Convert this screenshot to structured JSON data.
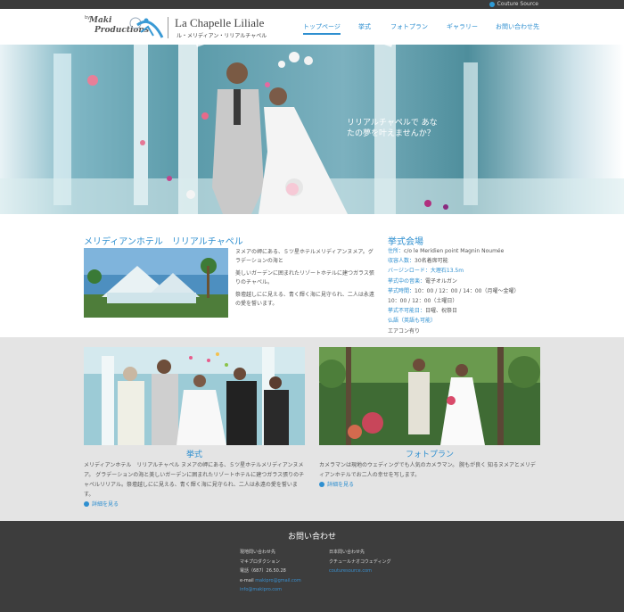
{
  "topbar": {
    "link": "Couture Source"
  },
  "logo": {
    "line1": "Maki",
    "line2": "Productions",
    "prefix": "by"
  },
  "brand": {
    "name": "La Chapelle Liliale",
    "sub": "ル・メリディアン・リリアルチャペル"
  },
  "nav": [
    "トップページ",
    "挙式",
    "フォトプラン",
    "ギャラリー",
    "お問い合わせ先"
  ],
  "hero": {
    "line1": "リリアルチャペルで あな",
    "line2": "たの夢を叶えませんか？"
  },
  "section1": {
    "title": "メリディアンホテル　リリアルチャペル",
    "p1": "ヌメアの岬にある、５ツ星ホテルメリディアンヌメア。グラデーションの海と",
    "p2": "美しいガーデンに囲まれたリゾートホテルに建つガラス張りのチャペル。",
    "p3": "祭壇越しにに見える、青く輝く海に見守られ、二人は永遠の愛を誓います。"
  },
  "info": {
    "title": "挙式会場",
    "rows": [
      {
        "k": "住所：",
        "v": "c/o le Meridien point Magnin Noumée"
      },
      {
        "k": "収容人数：",
        "v": "30名着席可能"
      },
      {
        "k": "バージンロード：",
        "v": "大理石13.5m"
      },
      {
        "k": "挙式中の音楽：",
        "v": "電子オルガン"
      },
      {
        "k": "挙式時間：",
        "v": "10：00 / 12：00 / 14：00（月曜〜金曜）"
      },
      {
        "k": "",
        "v": "10：00 / 12：00（土曜日）"
      },
      {
        "k": "挙式不可能日：",
        "v": "日曜、祝祭日"
      },
      {
        "k": "仏語（英語も可能）",
        "v": ""
      },
      {
        "k": "",
        "v": "エアコン有り"
      }
    ]
  },
  "cards": [
    {
      "title": "挙式",
      "text": "メリディアンホテル　リリアルチャペル ヌメアの岬にある、５ツ星ホテルメリディアンヌメア。 グラデーションの海と美しいガーデンに囲まれたリゾートホテルに建つガラス張りのチャペルリリアル。祭壇越しにに見える、青く輝く海に見守られ、二人は永遠の愛を誓います。",
      "more": "詳細を見る"
    },
    {
      "title": "フォトプラン",
      "text": "カメラマンは現地のウェディングでも人気のカメラマン。 腕もが良く 知るヌメアとメリディアンホテルでお二人の幸せを写します。",
      "more": "詳細を見る"
    }
  ],
  "footer": {
    "title": "お問い合わせ",
    "col1": [
      "現地問い合わせ先",
      "マキプロダクション",
      "電話（687）26.50.28",
      "e-mail",
      "makipro@gmail.com",
      "info@makipro.com"
    ],
    "col2": [
      "日本問い合わせ先",
      "クチュールナオコウェディング",
      "couturesource.com"
    ]
  },
  "colors": {
    "accent": "#2e8fd0",
    "footer_bg": "#3d3d3d",
    "gray_band": "#e4e4e4"
  }
}
